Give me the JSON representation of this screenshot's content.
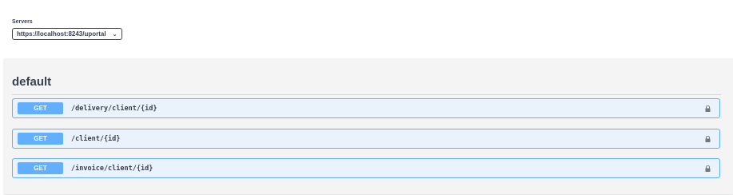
{
  "servers": {
    "label": "Servers",
    "selected": "https://localhost:8243/uportal",
    "chevron": "chevron-down-icon"
  },
  "section": {
    "title": "default"
  },
  "operations": [
    {
      "method": "GET",
      "path": "/delivery/client/{id}",
      "icon": "lock-icon"
    },
    {
      "method": "GET",
      "path": "/client/{id}",
      "icon": "lock-icon"
    },
    {
      "method": "GET",
      "path": "/invoice/client/{id}",
      "icon": "lock-icon"
    }
  ],
  "colors": {
    "get_accent": "#61affe",
    "get_background": "#eaf2fb",
    "text": "#3b4151",
    "section_background": "#f4f4f4"
  }
}
